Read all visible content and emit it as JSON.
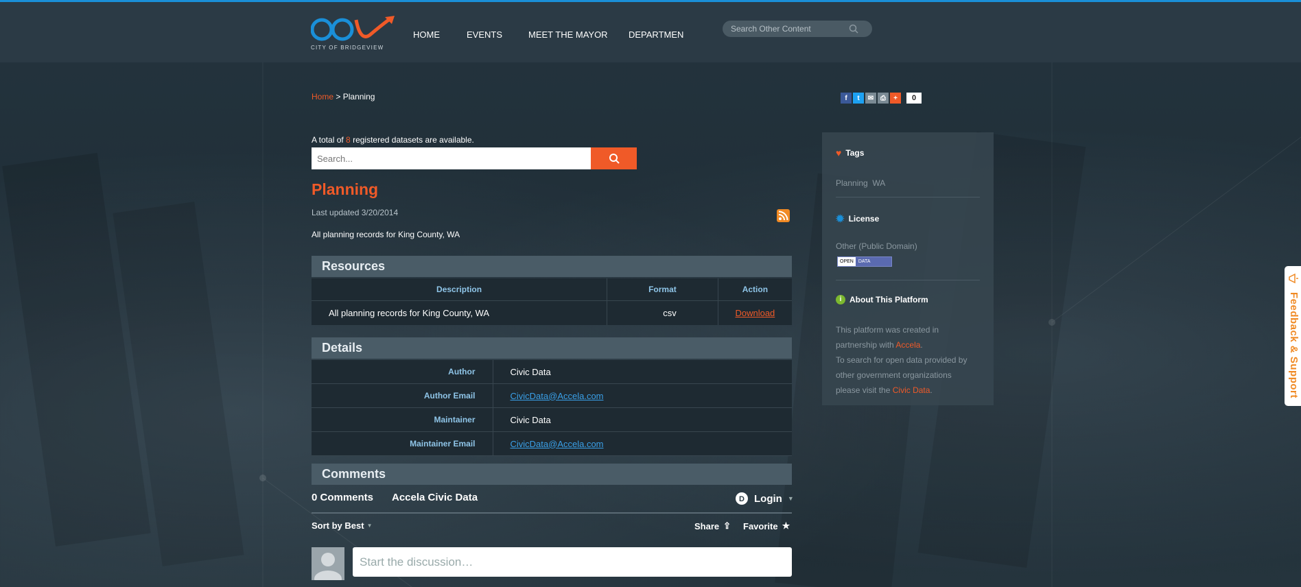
{
  "header": {
    "logo_text": "CITY OF BRIDGEVIEW",
    "nav": [
      {
        "label": "HOME"
      },
      {
        "label": "EVENTS"
      },
      {
        "label": "MEET THE MAYOR"
      },
      {
        "label": "DEPARTMEN"
      }
    ],
    "search_placeholder": "Search Other Content"
  },
  "breadcrumb": {
    "home": "Home",
    "separator": ">",
    "current": "Planning"
  },
  "share": {
    "count": "0",
    "icons": [
      "facebook-icon",
      "twitter-icon",
      "email-icon",
      "print-icon",
      "plus-icon"
    ]
  },
  "datasets": {
    "prefix": "A total of",
    "count": "8",
    "suffix": "registered datasets are available.",
    "search_placeholder": "Search..."
  },
  "dataset": {
    "title": "Planning",
    "updated": "Last updated 3/20/2014",
    "description": "All planning records for King County, WA"
  },
  "resources": {
    "heading": "Resources",
    "columns": {
      "description": "Description",
      "format": "Format",
      "action": "Action"
    },
    "rows": [
      {
        "description": "All planning records for King County, WA",
        "format": "csv",
        "action": "Download"
      }
    ]
  },
  "details": {
    "heading": "Details",
    "rows": [
      {
        "label": "Author",
        "value": "Civic Data"
      },
      {
        "label": "Author Email",
        "value": "CivicData@Accela.com"
      },
      {
        "label": "Maintainer",
        "value": "Civic Data"
      },
      {
        "label": "Maintainer Email",
        "value": "CivicData@Accela.com"
      }
    ]
  },
  "comments": {
    "heading": "Comments",
    "count": "0 Comments",
    "community": "Accela Civic Data",
    "login": "Login",
    "sort": "Sort by Best",
    "share": "Share",
    "favorite": "Favorite",
    "placeholder": "Start the discussion…"
  },
  "sidebar": {
    "tags_heading": "Tags",
    "tags": [
      "Planning",
      "WA"
    ],
    "license_heading": "License",
    "license": "Other (Public Domain)",
    "badge_left": "OPEN",
    "badge_right": "DATA",
    "about_heading": "About This Platform",
    "about_1": "This platform was created in",
    "about_2_prefix": "partnership with",
    "about_2_link": "Accela",
    "about_2_suffix": ".",
    "about_3": "To search for open data provided by",
    "about_4": "other government organizations",
    "about_5_prefix": "please visit the",
    "about_5_link": "Civic Data",
    "about_5_suffix": "."
  },
  "feedback": {
    "label": "Feedback & Support"
  },
  "colors": {
    "accent": "#f05a28",
    "link_blue": "#3aa0e8",
    "label_blue": "#8fc5e8",
    "top_bar": "#1a8fd8"
  }
}
